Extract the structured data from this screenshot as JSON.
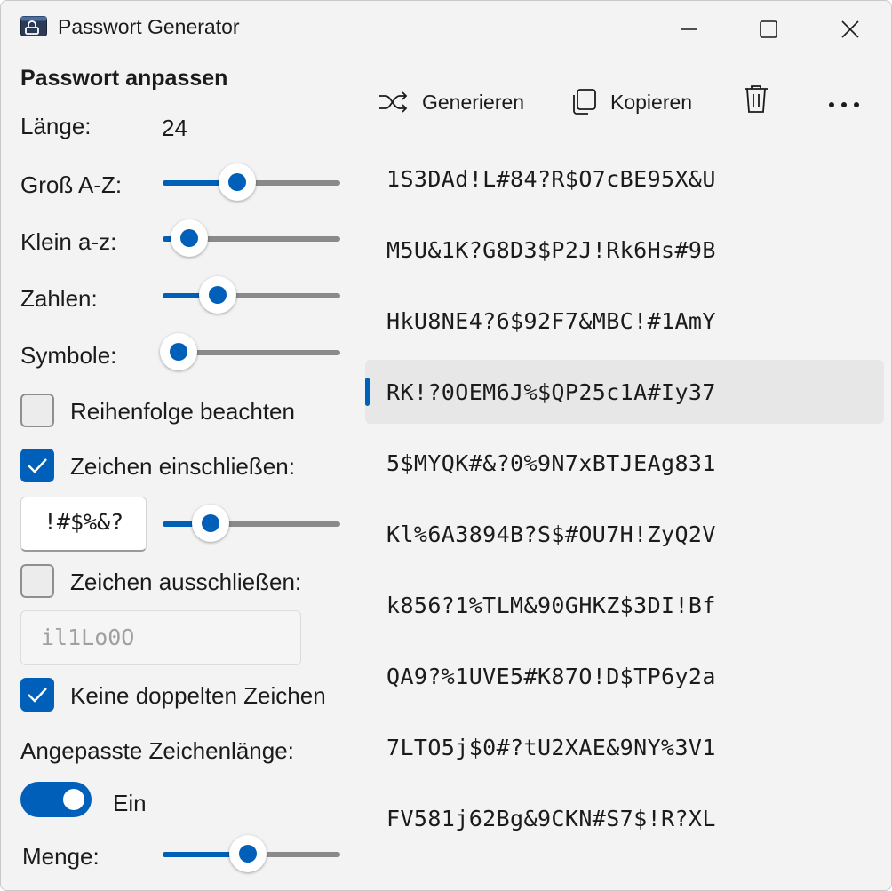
{
  "window": {
    "title": "Passwort Generator"
  },
  "sidebar": {
    "heading": "Passwort anpassen",
    "length": {
      "label": "Länge:",
      "value": "24"
    },
    "upper": {
      "label": "Groß A-Z:",
      "level": 0.42
    },
    "lower": {
      "label": "Klein a-z:",
      "level": 0.15
    },
    "numbers": {
      "label": "Zahlen:",
      "level": 0.31
    },
    "symbols": {
      "label": "Symbole:",
      "level": 0.09
    },
    "order": {
      "label": "Reihenfolge beachten",
      "checked": false
    },
    "include": {
      "label": "Zeichen einschließen:",
      "checked": true,
      "chars": "!#$%&?",
      "level": 0.27
    },
    "exclude": {
      "label": "Zeichen ausschließen:",
      "checked": false,
      "placeholder": "il1Lo0O"
    },
    "no_duplicates": {
      "label": "Keine doppelten Zeichen",
      "checked": true
    },
    "custom_length": {
      "label": "Angepasste Zeichenlänge:",
      "toggle_state": "Ein",
      "on": true
    },
    "amount": {
      "label": "Menge:",
      "level": 0.48
    }
  },
  "toolbar": {
    "generate": "Generieren",
    "copy": "Kopieren"
  },
  "passwords": [
    "1S3DAd!L#84?R$O7cBE95X&U",
    "M5U&1K?G8D3$P2J!Rk6Hs#9B",
    "HkU8NE4?6$92F7&MBC!#1AmY",
    "RK!?0OEM6J%$QP25c1A#Iy37",
    "5$MYQK#&?0%9N7xBTJEAg831",
    "Kl%6A3894B?S$#OU7H!ZyQ2V",
    "k856?1%TLM&90GHKZ$3DI!Bf",
    "QA9?%1UVE5#K87O!D$TP6y2a",
    "7LTO5j$0#?tU2XAE&9NY%3V1",
    "FV581j62Bg&9CKN#S7$!R?XL"
  ],
  "selected_index": 3,
  "colors": {
    "accent": "#005fb8",
    "background": "#f3f3f3",
    "selected_row": "#e7e7e7"
  }
}
